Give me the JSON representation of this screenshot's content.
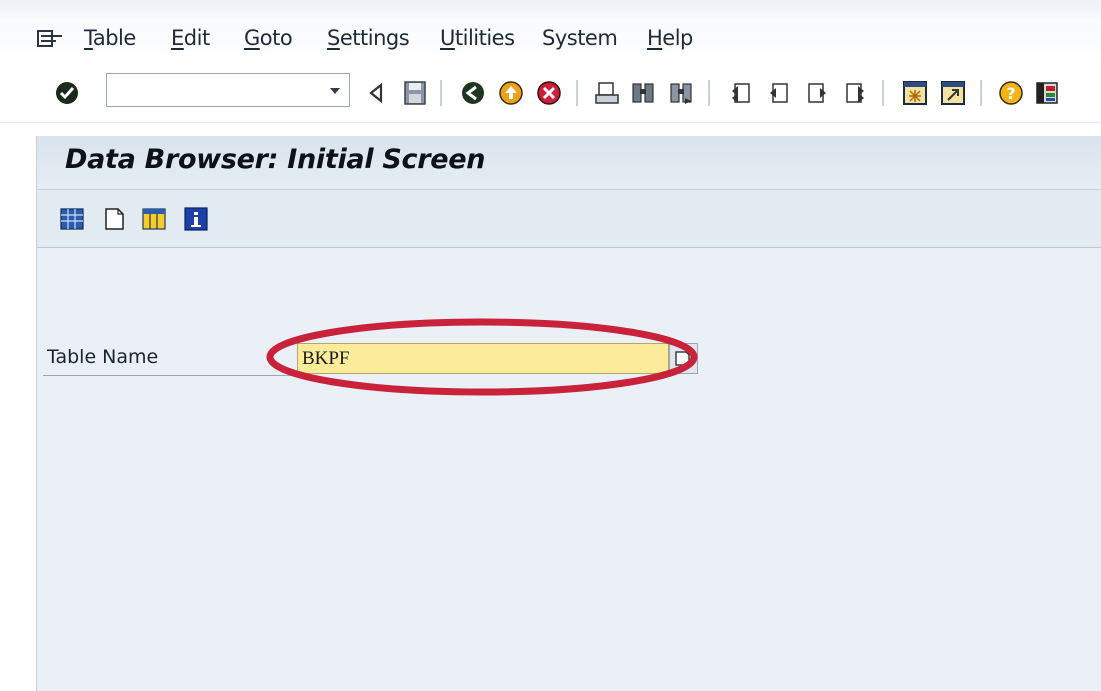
{
  "menu": {
    "items": [
      {
        "mnemonic": "T",
        "rest": "able"
      },
      {
        "mnemonic": "E",
        "rest": "dit"
      },
      {
        "mnemonic": "G",
        "rest": "oto"
      },
      {
        "mnemonic": "S",
        "rest": "ettings"
      },
      {
        "mnemonic": "U",
        "rest": "tilities"
      },
      {
        "mnemonic": "",
        "rest": "System"
      },
      {
        "mnemonic": "H",
        "rest": "elp"
      }
    ]
  },
  "toolbar": {
    "command_field_value": "",
    "icons": [
      "enter-icon",
      "back-arrow-icon",
      "save-icon",
      "back-icon",
      "exit-icon",
      "cancel-icon",
      "print-icon",
      "find-icon",
      "find-next-icon",
      "first-page-icon",
      "previous-page-icon",
      "next-page-icon",
      "last-page-icon",
      "create-session-icon",
      "generate-shortcut-icon",
      "help-icon",
      "customize-layout-icon"
    ]
  },
  "screen": {
    "title": "Data Browser: Initial Screen",
    "app_toolbar_icons": [
      "table-contents-icon",
      "create-entries-icon",
      "table-layout-icon",
      "info-icon"
    ]
  },
  "form": {
    "table_name_label": "Table Name",
    "table_name_value": "BKPF"
  },
  "colors": {
    "input_highlight": "#fbeb9a",
    "annotation_ellipse": "#c8233a",
    "title_bar": "#dde6ef"
  }
}
